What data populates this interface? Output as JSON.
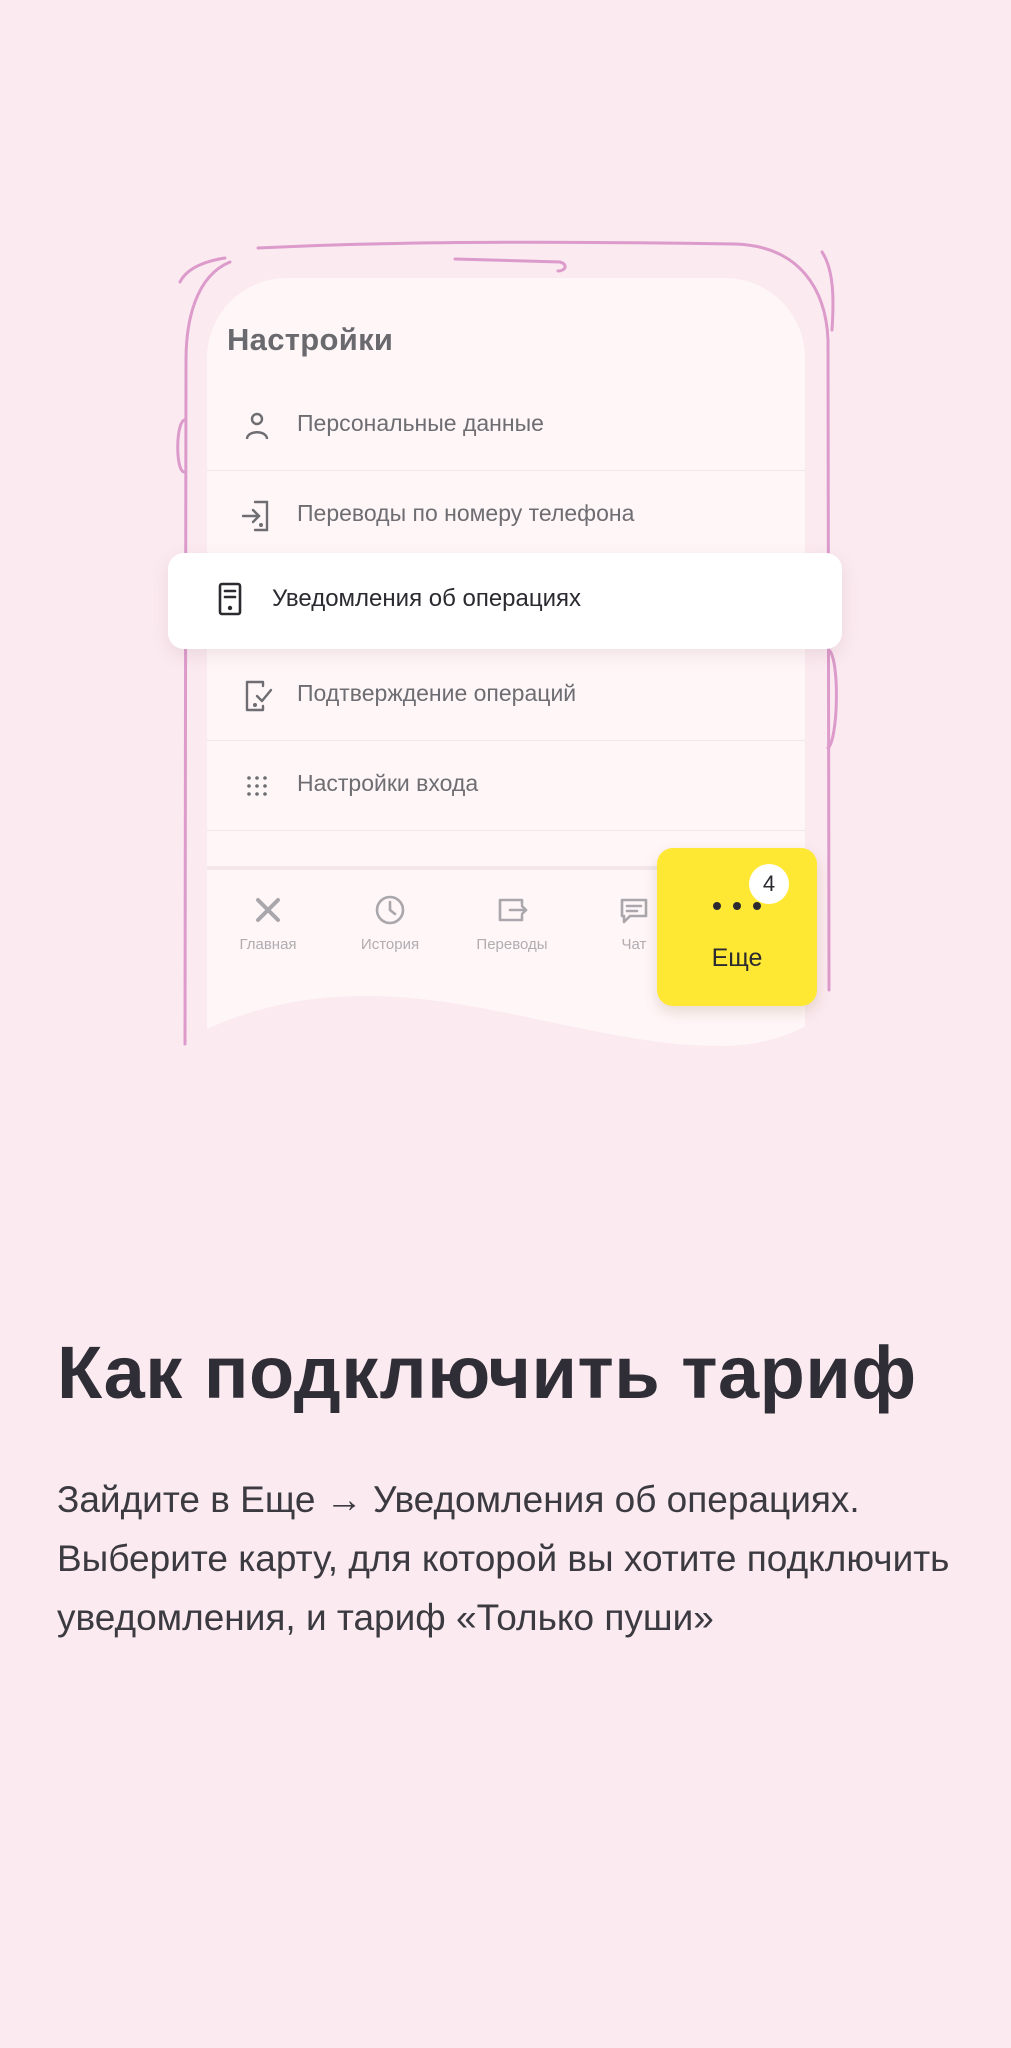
{
  "settings_screen": {
    "title": "Настройки",
    "items": [
      {
        "label": "Персональные данные",
        "icon": "person-icon"
      },
      {
        "label": "Переводы по номеру телефона",
        "icon": "transfer-in-icon"
      },
      {
        "label": "Уведомления об операциях",
        "icon": "phone-notification-icon",
        "highlighted": true
      },
      {
        "label": "Подтверждение операций",
        "icon": "phone-check-icon"
      },
      {
        "label": "Настройки входа",
        "icon": "keypad-dots-icon"
      }
    ]
  },
  "bottom_nav": {
    "items": [
      {
        "label": "Главная",
        "icon": "home-icon"
      },
      {
        "label": "История",
        "icon": "clock-icon"
      },
      {
        "label": "Переводы",
        "icon": "transfers-icon"
      },
      {
        "label": "Чат",
        "icon": "chat-icon"
      }
    ],
    "more": {
      "label": "Еще",
      "badge": "4",
      "icon": "more-dots-icon"
    }
  },
  "headline": "Как подключить тариф",
  "description": "Зайдите в Еще → Уведомления об операциях. Выберите карту, для которой вы хотите подключить уведомления, и тариф «Только пуши»",
  "colors": {
    "background": "#fbeaf0",
    "outline": "#dc9bcb",
    "accent": "#ffe833"
  }
}
